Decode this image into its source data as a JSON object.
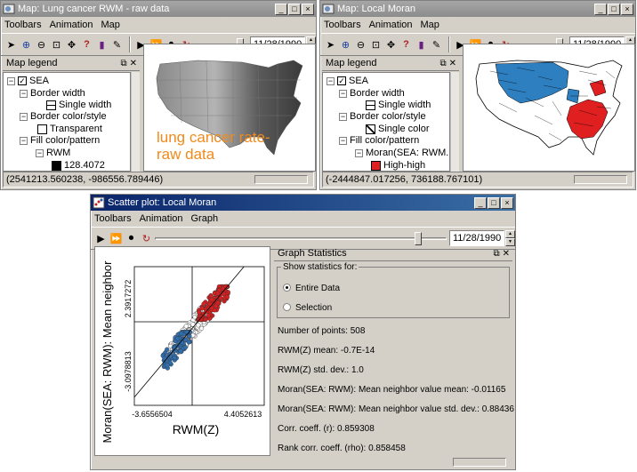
{
  "window_left": {
    "title": "Map: Lung cancer RWM - raw data",
    "menu": [
      "Toolbars",
      "Animation",
      "Map"
    ],
    "date": "11/28/1990",
    "legend_title": "Map legend",
    "legend_rows": [
      "SEA",
      "Border width",
      "Single width",
      "Border color/style",
      "Transparent",
      "Fill color/pattern",
      "RWM",
      "128.4072"
    ],
    "overlay_text_line1": "lung cancer rate-",
    "overlay_text_line2": "raw data",
    "overlay_color": "#f08a1c",
    "status": "(2541213.560238, -986556.789446)"
  },
  "window_right": {
    "title": "Map: Local Moran",
    "menu": [
      "Toolbars",
      "Animation",
      "Map"
    ],
    "date": "11/28/1990",
    "legend_title": "Map legend",
    "legend_rows": [
      "SEA",
      "Border width",
      "Single width",
      "Border color/style",
      "Single color",
      "Fill color/pattern",
      "Moran(SEA: RWM...",
      "High-high"
    ],
    "status": "(-2444847.017256, 736188.767101)",
    "colors": {
      "low_low": "#2e7fc0",
      "high_high": "#e02020"
    }
  },
  "window_scatter": {
    "title": "Scatter plot: Local Moran",
    "menu": [
      "Toolbars",
      "Animation",
      "Graph"
    ],
    "date": "11/28/1990",
    "stats_title": "Graph Statistics",
    "show_for": "Show statistics for:",
    "option_entire": "Entire Data",
    "option_selection": "Selection",
    "stats_lines": [
      "Number of points: 508",
      "RWM(Z) mean: -0.7E-14",
      "RWM(Z) std. dev.: 1.0",
      "Moran(SEA: RWM): Mean neighbor value mean: -0.01165",
      "Moran(SEA: RWM): Mean neighbor value std. dev.: 0.88436",
      "Corr. coeff. (r): 0.859308",
      "Rank corr. coeff. (rho): 0.858458"
    ]
  },
  "chart_data": {
    "type": "scatter",
    "xlabel": "RWM(Z)",
    "ylabel": "Moran(SEA: RWM): Mean neighbor",
    "x_ticks": [
      "-3.6556504",
      "4.4052613"
    ],
    "y_ticks": [
      "-3.0978813",
      "2.3917272"
    ],
    "xlim": [
      -3.6556504,
      4.4052613
    ],
    "ylim": [
      -3.0978813,
      2.3917272
    ],
    "regression_slope": 0.76,
    "groups": [
      {
        "name": "high-high",
        "color": "#d82020",
        "x_range": [
          0.3,
          2.2
        ],
        "y_range": [
          0.3,
          1.6
        ],
        "count": 150
      },
      {
        "name": "low-low",
        "color": "#2f6fb0",
        "x_range": [
          -1.9,
          -0.2
        ],
        "y_range": [
          -1.7,
          -0.2
        ],
        "count": 90
      },
      {
        "name": "other",
        "color": "#ffffff",
        "x_range": [
          -1.4,
          1.0
        ],
        "y_range": [
          -1.0,
          0.8
        ],
        "count": 260
      }
    ]
  }
}
